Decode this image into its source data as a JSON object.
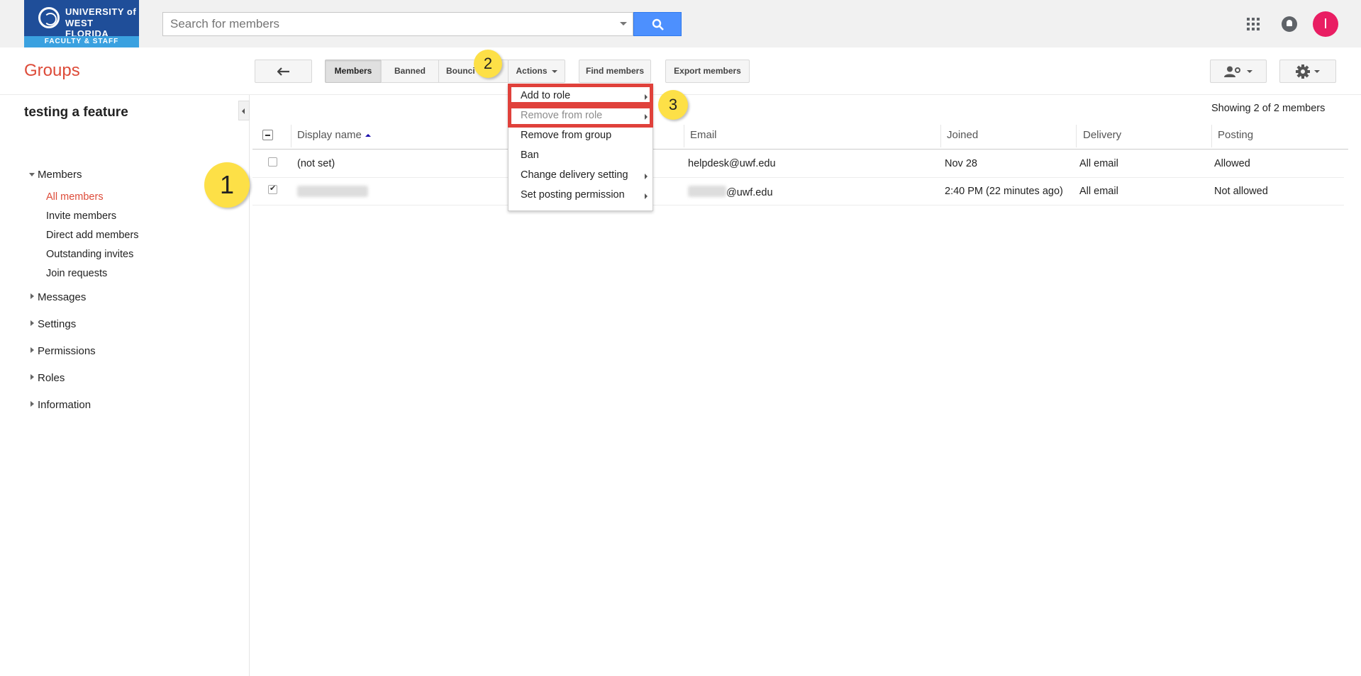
{
  "logo": {
    "line1": "UNIVERSITY of",
    "line2": "WEST FLORIDA",
    "band": "FACULTY & STAFF"
  },
  "search": {
    "placeholder": "Search for members"
  },
  "header": {
    "avatar_letter": "I"
  },
  "app_title": "Groups",
  "toolbar": {
    "members_tab": "Members",
    "banned_tab": "Banned",
    "bouncing_tab": "Bounci",
    "actions_label": "Actions",
    "find_members": "Find members",
    "export_members": "Export members"
  },
  "sidebar": {
    "group_name": "testing a feature",
    "members": "Members",
    "sub_items": [
      "All members",
      "Invite members",
      "Direct add members",
      "Outstanding invites",
      "Join requests"
    ],
    "sections": [
      "Messages",
      "Settings",
      "Permissions",
      "Roles",
      "Information"
    ]
  },
  "table": {
    "showing": "Showing 2 of 2 members",
    "columns": [
      "Display name",
      "Email",
      "Joined",
      "Delivery",
      "Posting"
    ],
    "rows": [
      {
        "name": "(not set)",
        "email": "helpdesk@uwf.edu",
        "joined": "Nov 28",
        "delivery": "All email",
        "posting": "Allowed",
        "checked": false
      },
      {
        "name": "",
        "email": "@uwf.edu",
        "joined": "2:40 PM (22 minutes ago)",
        "delivery": "All email",
        "posting": "Not allowed",
        "checked": true
      }
    ]
  },
  "actions_menu": {
    "items": [
      "Add to role",
      "Remove from role",
      "Remove from group",
      "Ban",
      "Change delivery setting",
      "Set posting permission"
    ]
  },
  "callouts": [
    "1",
    "2",
    "3"
  ],
  "colors": {
    "brand_red": "#dd4b39",
    "search_blue": "#4d90fe",
    "highlight": "#e0413b",
    "callout": "#fde047",
    "logo_blue": "#1f4e99"
  }
}
